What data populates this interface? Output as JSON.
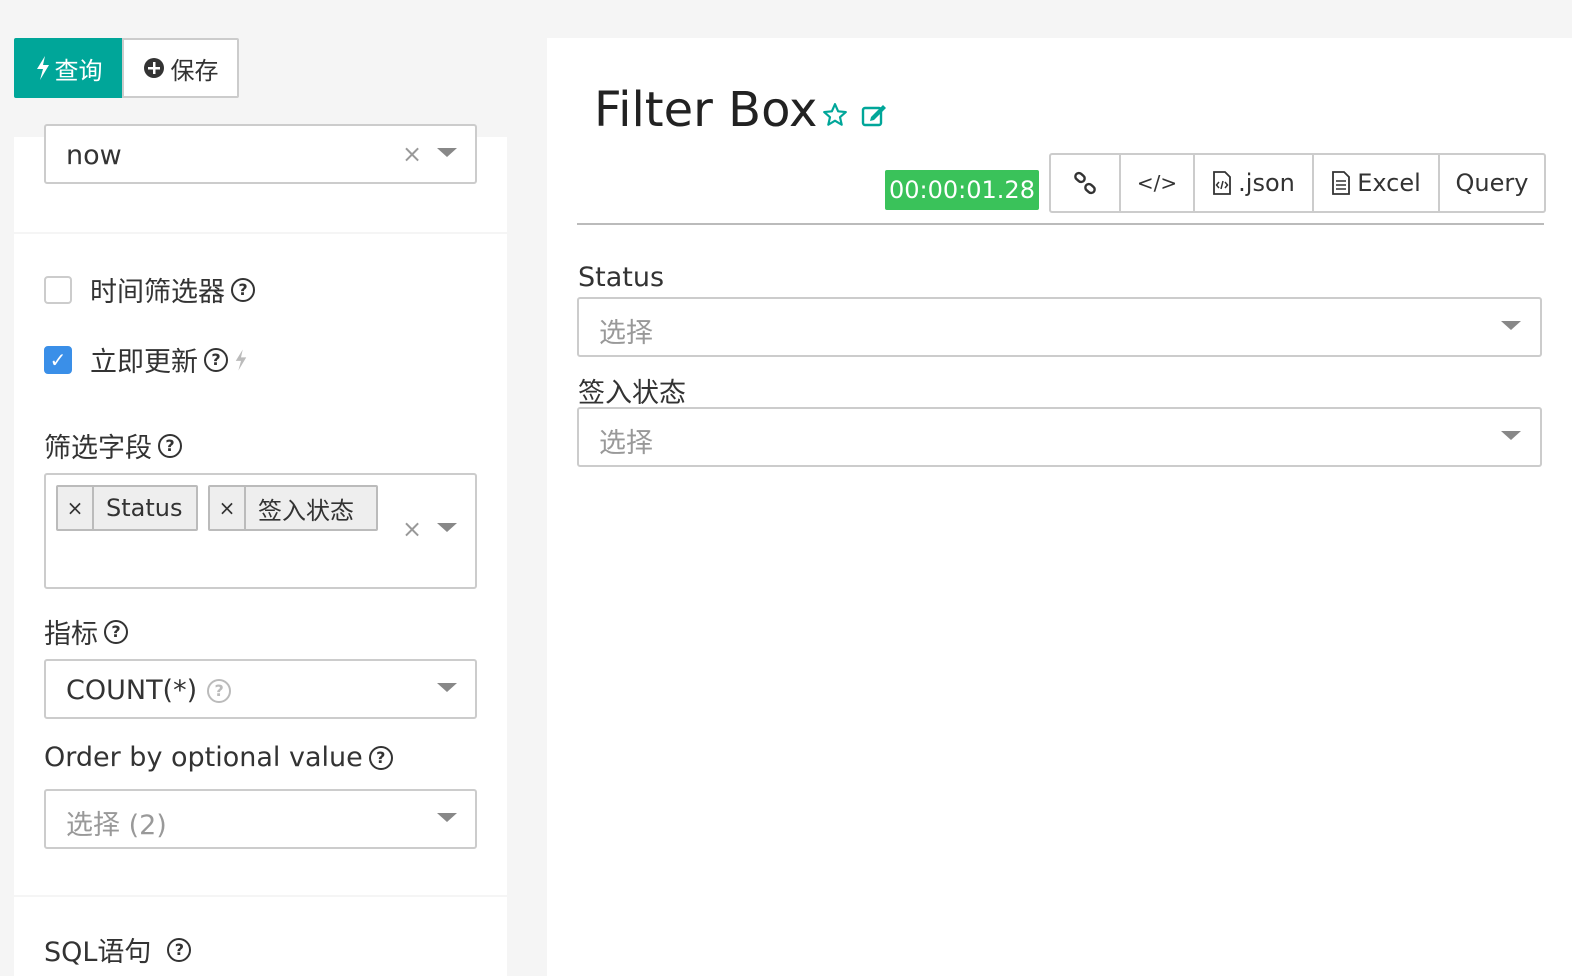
{
  "toolbar": {
    "query_label": "查询",
    "save_label": "保存"
  },
  "left": {
    "since_value": "now",
    "time_filter_label": "时间筛选器",
    "instant_update_label": "立即更新",
    "filter_fields_label": "筛选字段",
    "filter_tags": [
      "Status",
      "签入状态"
    ],
    "metric_label": "指标",
    "metric_value": "COUNT(*)",
    "order_label": "Order by optional value",
    "order_placeholder": "选择 (2)",
    "sql_label": "SQL语句"
  },
  "right": {
    "title": "Filter Box",
    "timer": "00:00:01.28",
    "actions": {
      "json": ".json",
      "excel": "Excel",
      "query": "Query"
    },
    "filters": [
      {
        "label": "Status",
        "placeholder": "选择"
      },
      {
        "label": "签入状态",
        "placeholder": "选择"
      }
    ]
  },
  "colors": {
    "primary": "#00a699",
    "success": "#3ac25a",
    "checkbox": "#3a8fe8"
  }
}
